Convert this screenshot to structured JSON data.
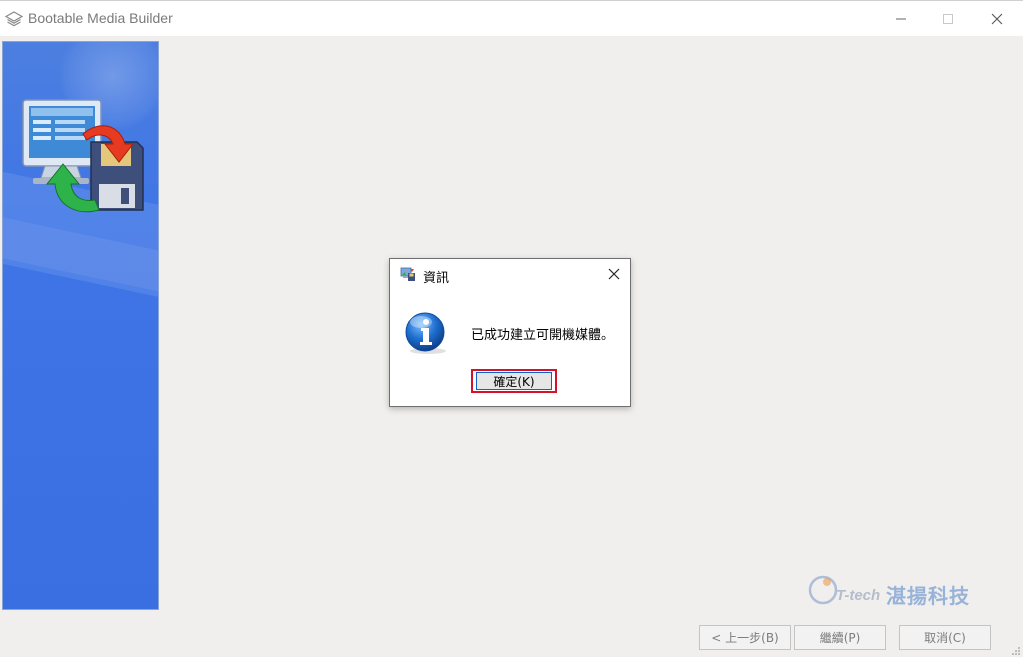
{
  "window": {
    "title": "Bootable Media Builder",
    "minimize_glyph": "—",
    "maximize_glyph": "☐",
    "close_glyph": "✕"
  },
  "dialog": {
    "title": "資訊",
    "message": "已成功建立可開機媒體。",
    "ok_label": "確定(K)",
    "close_glyph": "✕",
    "icons": {
      "title_icon": "app-icon",
      "body_icon": "info-icon"
    }
  },
  "nav": {
    "back_label": "< 上一步(B)",
    "next_label": "繼續(P)",
    "cancel_label": "取消(C)"
  },
  "watermark": {
    "brand_latin": "T-tech",
    "brand_cjk": "湛揚科技"
  },
  "colors": {
    "sidebar_blue": "#3f75e6",
    "ok_highlight": "#d8112a",
    "info_blue": "#1f6fd0"
  }
}
